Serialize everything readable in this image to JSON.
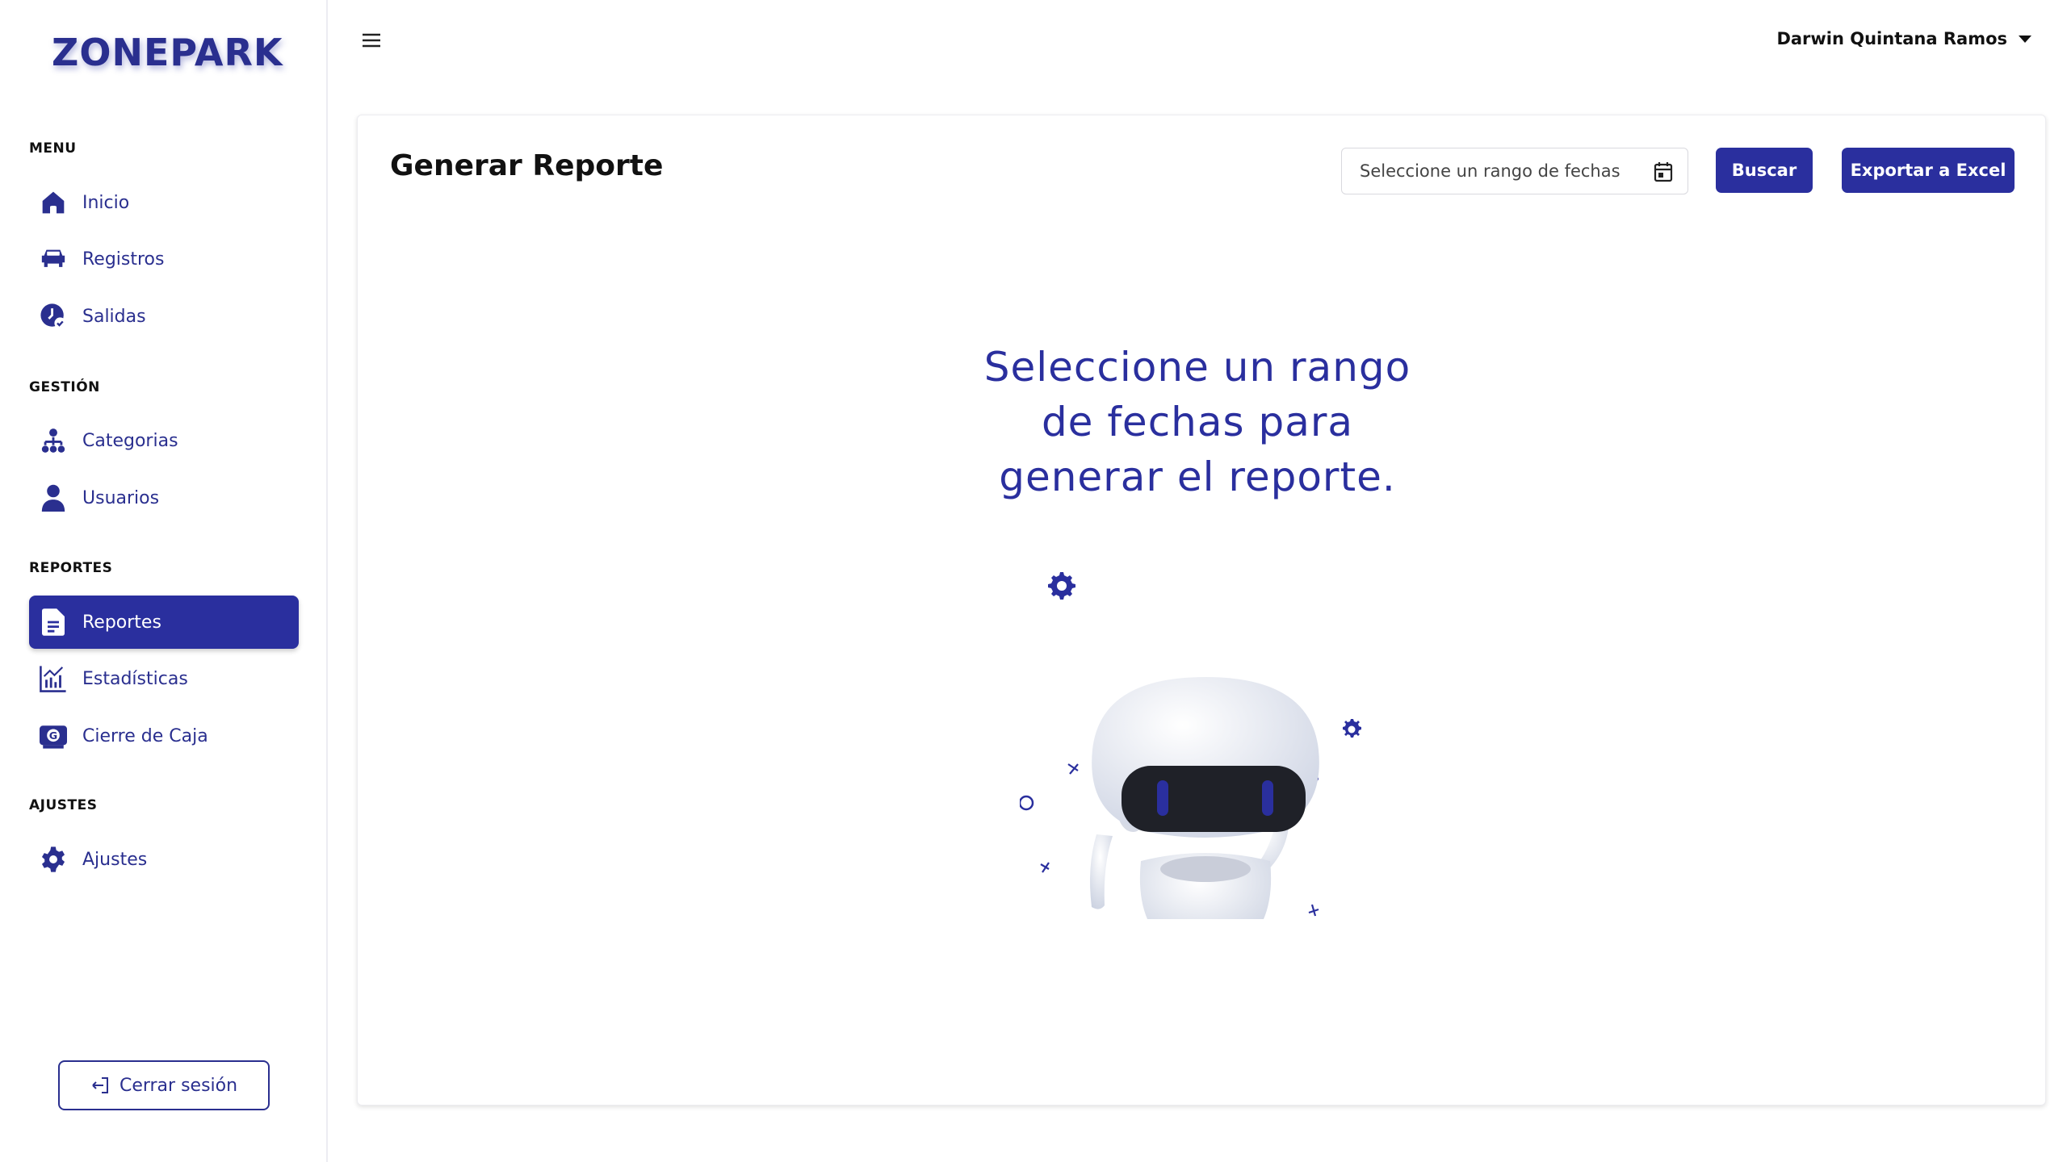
{
  "brand": {
    "part1": "ZONE",
    "part2": "PARK"
  },
  "sidebar": {
    "sections": [
      {
        "title": "MENU"
      },
      {
        "title": "GESTIÓN"
      },
      {
        "title": "REPORTES"
      },
      {
        "title": "AJUSTES"
      }
    ],
    "items": [
      {
        "label": "Inicio",
        "icon": "home-icon"
      },
      {
        "label": "Registros",
        "icon": "car-icon"
      },
      {
        "label": "Salidas",
        "icon": "clock-check-icon"
      },
      {
        "label": "Categorias",
        "icon": "hierarchy-icon"
      },
      {
        "label": "Usuarios",
        "icon": "user-icon"
      },
      {
        "label": "Reportes",
        "icon": "document-icon",
        "active": true
      },
      {
        "label": "Estadísticas",
        "icon": "bar-chart-icon"
      },
      {
        "label": "Cierre de Caja",
        "icon": "cash-register-icon"
      },
      {
        "label": "Ajustes",
        "icon": "gear-icon"
      }
    ],
    "logout_label": "Cerrar sesión"
  },
  "topbar": {
    "user_name": "Darwin Quintana Ramos"
  },
  "report": {
    "title": "Generar Reporte",
    "date_placeholder": "Seleccione un rango de fechas",
    "search_label": "Buscar",
    "export_label": "Exportar a Excel",
    "empty_line1": "Seleccione un rango",
    "empty_line2": "de fechas para",
    "empty_line3": "generar el reporte."
  },
  "colors": {
    "primary": "#2a2f9e",
    "text": "#111111"
  }
}
